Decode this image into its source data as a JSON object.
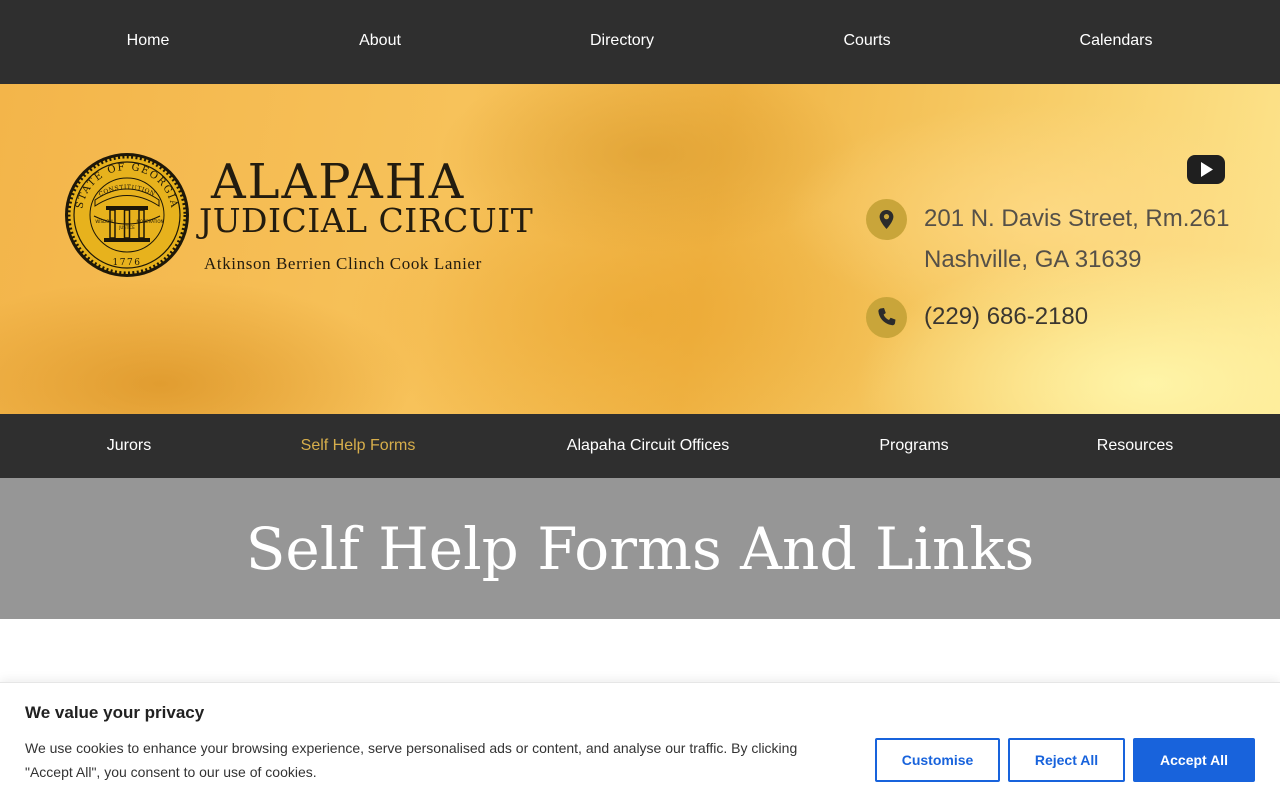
{
  "top_nav": {
    "items": [
      {
        "label": "Home"
      },
      {
        "label": "About"
      },
      {
        "label": "Directory"
      },
      {
        "label": "Courts"
      },
      {
        "label": "Calendars"
      }
    ]
  },
  "header": {
    "seal": {
      "top_text": "STATE OF GEORGIA",
      "banner_text": "CONSTITUTION",
      "ribbon_words": [
        "WISDOM",
        "JUSTICE",
        "MODERATION"
      ],
      "year": "1776"
    },
    "title": "ALAPAHA",
    "subtitle": "JUDICIAL CIRCUIT",
    "counties": "Atkinson Berrien Clinch Cook Lanier",
    "youtube_icon": "youtube-play-icon",
    "address_line1": "201 N. Davis Street, Rm.261",
    "address_line2": "Nashville, GA 31639",
    "phone": "(229) 686-2180",
    "accent_color": "#c9a53a"
  },
  "sub_nav": {
    "items": [
      {
        "label": "Jurors"
      },
      {
        "label": "Self Help Forms"
      },
      {
        "label": "Alapaha Circuit Offices"
      },
      {
        "label": "Programs"
      },
      {
        "label": "Resources"
      }
    ],
    "active_color": "#d7ae4b"
  },
  "page": {
    "title": "Self Help Forms And Links"
  },
  "cookie_banner": {
    "title": "We value your privacy",
    "text": "We use cookies to enhance your browsing experience, serve personalised ads or content, and analyse our traffic. By clicking \"Accept All\", you consent to our use of cookies.",
    "customise_label": "Customise",
    "reject_label": "Reject All",
    "accept_label": "Accept All",
    "button_color": "#1863dc"
  }
}
